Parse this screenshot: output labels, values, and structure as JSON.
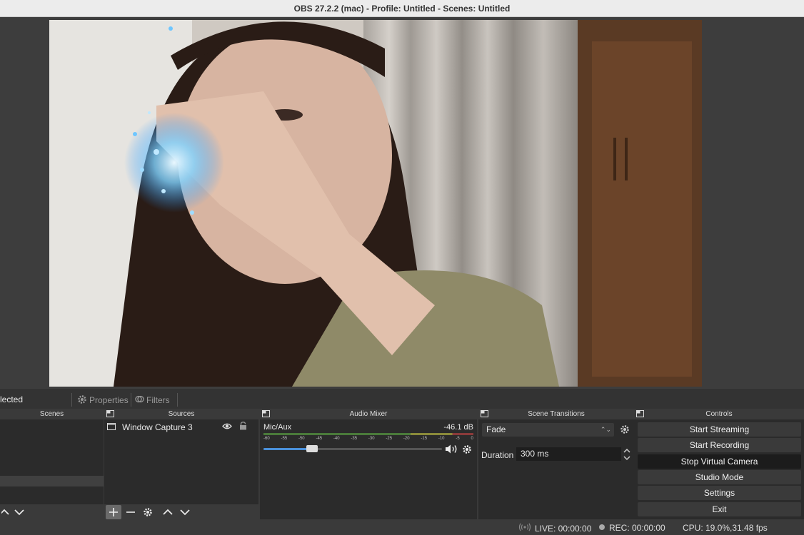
{
  "window": {
    "title": "OBS 27.2.2 (mac) - Profile: Untitled - Scenes: Untitled"
  },
  "context_bar": {
    "selected_label": "lected",
    "properties_label": "Properties",
    "filters_label": "Filters"
  },
  "docks": {
    "scenes": {
      "title": "Scenes"
    },
    "sources": {
      "title": "Sources",
      "items": [
        {
          "label": "Window Capture 3"
        }
      ]
    },
    "audio_mixer": {
      "title": "Audio Mixer",
      "channel": {
        "name": "Mic/Aux",
        "level": "-46.1 dB",
        "volume": 0.27
      },
      "ticks": [
        "-60",
        "-55",
        "-50",
        "-45",
        "-40",
        "-35",
        "-30",
        "-25",
        "-20",
        "-15",
        "-10",
        "-5",
        "0"
      ]
    },
    "scene_transitions": {
      "title": "Scene Transitions",
      "transition": "Fade",
      "duration_label": "Duration",
      "duration_value": "300 ms"
    },
    "controls": {
      "title": "Controls",
      "buttons": [
        "Start Streaming",
        "Start Recording",
        "Stop Virtual Camera",
        "Studio Mode",
        "Settings",
        "Exit"
      ]
    }
  },
  "status": {
    "live": "LIVE: 00:00:00",
    "rec": "REC: 00:00:00",
    "cpu": "CPU: 19.0%,31.48 fps"
  },
  "colors": {
    "background": "#3a3a3a",
    "dock_bg": "#2b2b2b",
    "accent": "#4a90d9",
    "active_button": "#1c1c1c"
  }
}
